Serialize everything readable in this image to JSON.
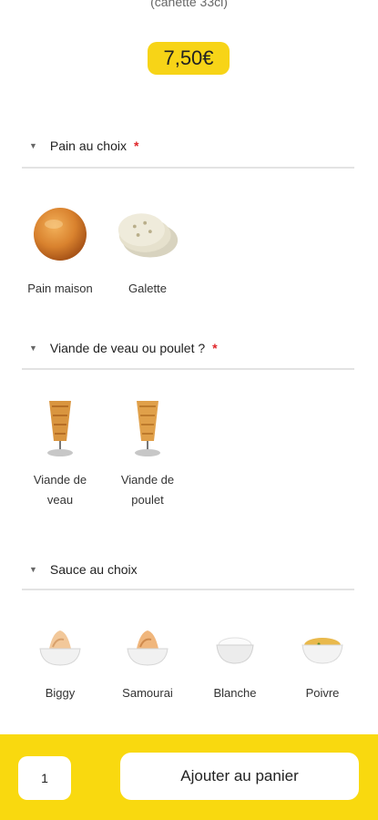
{
  "product": {
    "subtitle": "(canette 33cl)",
    "price": "7,50€"
  },
  "sections": [
    {
      "title": "Pain au choix",
      "required_mark": "*",
      "options": [
        {
          "label": "Pain maison",
          "icon": "bread-bun-icon"
        },
        {
          "label": "Galette",
          "icon": "flatbread-icon"
        }
      ]
    },
    {
      "title": "Viande de veau ou poulet ?",
      "required_mark": "*",
      "options": [
        {
          "label_line1": "Viande de",
          "label_line2": "veau",
          "icon": "kebab-spit-icon"
        },
        {
          "label_line1": "Viande de",
          "label_line2": "poulet",
          "icon": "kebab-spit-icon"
        }
      ]
    },
    {
      "title": "Sauce au choix",
      "options": [
        {
          "label": "Biggy",
          "icon": "sauce-bowl-icon"
        },
        {
          "label": "Samourai",
          "icon": "sauce-bowl-icon"
        },
        {
          "label": "Blanche",
          "icon": "sauce-bowl-icon"
        },
        {
          "label": "Poivre",
          "icon": "sauce-bowl-icon"
        }
      ]
    }
  ],
  "footer": {
    "quantity": "1",
    "add_label": "Ajouter au panier"
  },
  "colors": {
    "accent_yellow": "#f9d90f",
    "required_red": "#e0262a"
  }
}
